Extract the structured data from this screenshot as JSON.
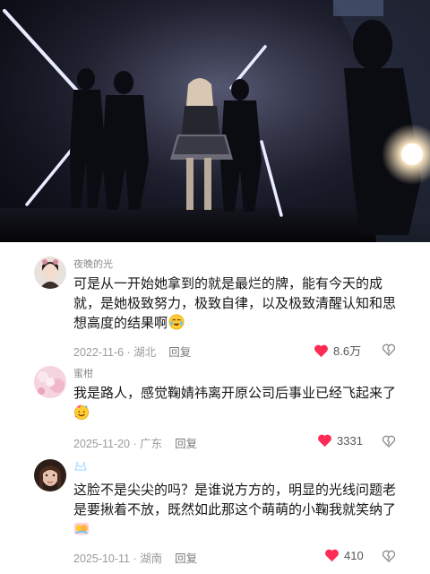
{
  "comments": [
    {
      "username": "夜晚的光",
      "text": "可是从一开始她拿到的就是最烂的牌，能有今天的成就，是她极致努力，极致自律，以及极致清醒认知和思想高度的结果啊",
      "emoji": "teary-smile-emoji",
      "date": "2022-11-6",
      "location": "湖北",
      "reply_label": "回复",
      "likes": "8.6万",
      "liked": true
    },
    {
      "username": "蜜柑",
      "text": "我是路人，感觉鞠婧祎离开原公司后事业已经飞起来了",
      "emoji": "party-face-emoji",
      "date": "2025-11-20",
      "location": "广东",
      "reply_label": "回复",
      "likes": "3331",
      "liked": true
    },
    {
      "username": "",
      "text": "这脸不是尖尖的吗？是谁说方方的，明显的光线问题老是要揪着不放，既然如此那这个萌萌的小鞠我就笑纳了",
      "emoji": "hug-emoji",
      "date": "2025-10-11",
      "location": "湖南",
      "reply_label": "回复",
      "likes": "410",
      "liked": true
    }
  ],
  "colors": {
    "like": "#fe2c55",
    "meta": "#9b9b9b",
    "text": "#161616"
  },
  "icons": [
    "heart-icon",
    "dislike-heart-icon",
    "sparkle-icon"
  ]
}
